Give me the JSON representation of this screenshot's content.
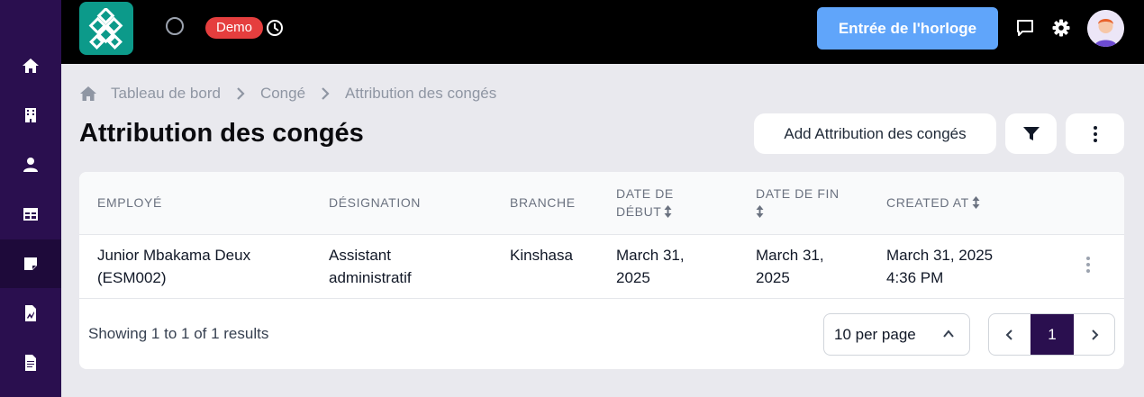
{
  "topbar": {
    "badge": "Demo",
    "clock_button": "Entrée de l'horloge"
  },
  "breadcrumb": [
    "Tableau de bord",
    "Congé",
    "Attribution des congés"
  ],
  "page": {
    "title": "Attribution des congés",
    "add_button": "Add Attribution des congés"
  },
  "table": {
    "headers": {
      "employee": "EMPLOYÉ",
      "designation": "DÉSIGNATION",
      "branch": "BRANCHE",
      "start_line1": "DATE DE",
      "start_line2": "DÉBUT",
      "end_line1": "DATE DE FIN",
      "created": "CREATED AT"
    },
    "rows": [
      {
        "employee_line1": "Junior Mbakama Deux",
        "employee_line2": "(ESM002)",
        "designation_line1": "Assistant",
        "designation_line2": "administratif",
        "branch": "Kinshasa",
        "start_line1": "March 31,",
        "start_line2": "2025",
        "end_line1": "March 31,",
        "end_line2": "2025",
        "created_line1": "March 31, 2025",
        "created_line2": "4:36 PM"
      }
    ]
  },
  "pagination": {
    "summary": "Showing 1 to 1 of 1 results",
    "per_page": "10 per page",
    "current_page": "1"
  },
  "icons": {
    "sidebar": [
      "home-icon",
      "building-icon",
      "user-icon",
      "table-icon",
      "note-icon",
      "chart-file-icon",
      "document-icon"
    ]
  },
  "colors": {
    "sidebar": "#2a0f4f",
    "topbar": "#000000",
    "accent": "#60a5fa",
    "badge": "#e53e3e",
    "logo": "#0c9a8a"
  }
}
